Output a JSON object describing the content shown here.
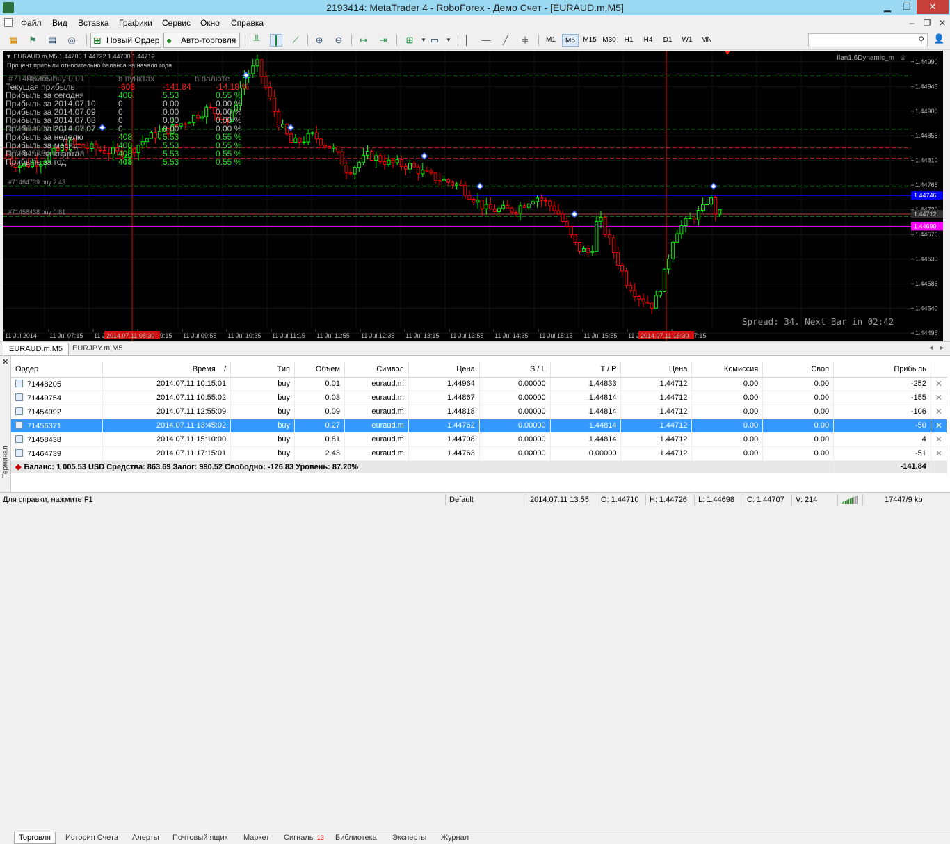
{
  "window": {
    "title": "2193414: MetaTrader 4 - RoboForex - Демо Счет - [EURAUD.m,M5]",
    "min": "▁",
    "max": "❐",
    "close": "✕"
  },
  "menu": [
    "Файл",
    "Вид",
    "Вставка",
    "Графики",
    "Сервис",
    "Окно",
    "Справка"
  ],
  "mdi": {
    "min": "–",
    "restore": "❐",
    "close": "✕"
  },
  "toolbar": {
    "new_order": "Новый Ордер",
    "autotrade": "Авто-торговля",
    "timeframes": [
      "M1",
      "M5",
      "M15",
      "M30",
      "H1",
      "H4",
      "D1",
      "W1",
      "MN"
    ],
    "selected_tf": "M5"
  },
  "chart": {
    "header": "EURAUD.m,M5  1.44705 1.44722 1.44700 1.44712",
    "indicator_label": "Процент прибыли относительно баланса на начало года",
    "ea_label": "Ilan1.6Dynamic_m",
    "spread_text": "Spread: 34. Next Bar in 02:42",
    "stats_headers": [
      "Прибыль",
      "в пунктах",
      "в валюте"
    ],
    "stats": [
      {
        "label": "Текущая прибыль",
        "points": "-608",
        "money": "-141.84",
        "pct": "-14.18 %"
      },
      {
        "label": "Прибыль за сегодня",
        "points": "408",
        "money": "5.53",
        "pct": "0.55 %"
      },
      {
        "label": "Прибыль за 2014.07.10",
        "points": "0",
        "money": "0.00",
        "pct": "0.00 %"
      },
      {
        "label": "Прибыль за 2014.07.09",
        "points": "0",
        "money": "0.00",
        "pct": "0.00 %"
      },
      {
        "label": "Прибыль за 2014.07.08",
        "points": "0",
        "money": "0.00",
        "pct": "0.00 %"
      },
      {
        "label": "Прибыль за 2014.07.07",
        "points": "0",
        "money": "0.00",
        "pct": "0.00 %"
      },
      {
        "label": "Прибыль за неделю",
        "points": "408",
        "money": "5.53",
        "pct": "0.55 %"
      },
      {
        "label": "Прибыль за месяц",
        "points": "408",
        "money": "5.53",
        "pct": "0.55 %"
      },
      {
        "label": "Прибыль за квартал",
        "points": "408",
        "money": "5.53",
        "pct": "0.55 %"
      },
      {
        "label": "Прибыль за год",
        "points": "408",
        "money": "5.53",
        "pct": "0.55 %"
      }
    ],
    "overlap_labels": [
      "#71448205 buy 0.01",
      "#71454992 buy 0.09",
      "#71449754 buy 0.03"
    ],
    "order_labels": [
      {
        "text": "#71464739 buy 2.43",
        "price": 1.44763
      },
      {
        "text": "#71458438 buy 0.81",
        "price": 1.44708
      }
    ],
    "price_ticks": [
      "1.44990",
      "1.44945",
      "1.44900",
      "1.44855",
      "1.44810",
      "1.44765",
      "1.44720",
      "1.44675",
      "1.44630",
      "1.44585",
      "1.44540",
      "1.44495"
    ],
    "bid_tag": "1.44712",
    "ask_tag": "1.44746",
    "pink_tag": "1.44690",
    "tag_blue_mid": "1.44720",
    "time_labels": [
      "11 Jul 2014",
      "11 Jul 07:15",
      "11 Jul 08:35",
      "11 Jul 09:15",
      "11 Jul 09:55",
      "11 Jul 10:35",
      "11 Jul 11:15",
      "11 Jul 11:55",
      "11 Jul 12:35",
      "11 Jul 13:15",
      "11 Jul 13:55",
      "11 Jul 14:35",
      "11 Jul 15:15",
      "11 Jul 15:55",
      "11 Jul 16:35",
      "11 Jul 17:15"
    ],
    "cursor_time1": "2014.07.11 08:30",
    "cursor_time2": "2014.07.11 16:30",
    "colors": {
      "bull": "#00ff00",
      "bear": "#ff0000",
      "bg": "#000000",
      "ask": "#0000ff",
      "pink": "#ff00ff",
      "grid": "#1a1a1a"
    }
  },
  "chart_tabs": [
    "EURAUD.m,M5",
    "EURJPY.m,M5"
  ],
  "terminal": {
    "side_label": "Терминал",
    "headers": [
      "Ордер",
      "Время",
      "Тип",
      "Объем",
      "Символ",
      "Цена",
      "S / L",
      "T / P",
      "Цена",
      "Комиссия",
      "Своп",
      "Прибыль"
    ],
    "sort_mark": "/",
    "rows": [
      {
        "order": "71448205",
        "time": "2014.07.11 10:15:01",
        "type": "buy",
        "vol": "0.01",
        "sym": "euraud.m",
        "price": "1.44964",
        "sl": "0.00000",
        "tp": "1.44833",
        "cur": "1.44712",
        "comm": "0.00",
        "swap": "0.00",
        "profit": "-252"
      },
      {
        "order": "71449754",
        "time": "2014.07.11 10:55:02",
        "type": "buy",
        "vol": "0.03",
        "sym": "euraud.m",
        "price": "1.44867",
        "sl": "0.00000",
        "tp": "1.44814",
        "cur": "1.44712",
        "comm": "0.00",
        "swap": "0.00",
        "profit": "-155"
      },
      {
        "order": "71454992",
        "time": "2014.07.11 12:55:09",
        "type": "buy",
        "vol": "0.09",
        "sym": "euraud.m",
        "price": "1.44818",
        "sl": "0.00000",
        "tp": "1.44814",
        "cur": "1.44712",
        "comm": "0.00",
        "swap": "0.00",
        "profit": "-106"
      },
      {
        "order": "71456371",
        "time": "2014.07.11 13:45:02",
        "type": "buy",
        "vol": "0.27",
        "sym": "euraud.m",
        "price": "1.44762",
        "sl": "0.00000",
        "tp": "1.44814",
        "cur": "1.44712",
        "comm": "0.00",
        "swap": "0.00",
        "profit": "-50"
      },
      {
        "order": "71458438",
        "time": "2014.07.11 15:10:00",
        "type": "buy",
        "vol": "0.81",
        "sym": "euraud.m",
        "price": "1.44708",
        "sl": "0.00000",
        "tp": "1.44814",
        "cur": "1.44712",
        "comm": "0.00",
        "swap": "0.00",
        "profit": "4"
      },
      {
        "order": "71464739",
        "time": "2014.07.11 17:15:01",
        "type": "buy",
        "vol": "2.43",
        "sym": "euraud.m",
        "price": "1.44763",
        "sl": "0.00000",
        "tp": "0.00000",
        "cur": "1.44712",
        "comm": "0.00",
        "swap": "0.00",
        "profit": "-51"
      }
    ],
    "selected_row": 3,
    "summary": "Баланс: 1 005.53 USD  Средства: 863.69  Залог: 990.52  Свободно: -126.83  Уровень: 87.20%",
    "summary_profit": "-141.84",
    "tabs": [
      "Торговля",
      "История Счета",
      "Алерты",
      "Почтовый ящик",
      "Маркет",
      "Сигналы",
      "Библиотека",
      "Эксперты",
      "Журнал"
    ],
    "signals_badge": "13"
  },
  "status": {
    "help": "Для справки, нажмите F1",
    "profile": "Default",
    "datetime": "2014.07.11 13:55",
    "open": "O: 1.44710",
    "high": "H: 1.44726",
    "low": "L: 1.44698",
    "close": "C: 1.44707",
    "volume": "V: 214",
    "traffic": "17447/9 kb"
  }
}
